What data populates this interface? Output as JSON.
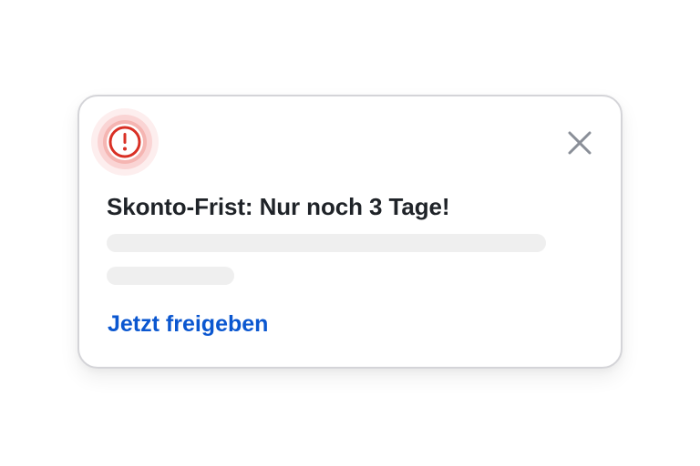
{
  "notification": {
    "icon": "alert-circle-icon",
    "accent_color": "#d93025",
    "title": "Skonto-Frist: Nur noch 3 Tage!",
    "action_label": "Jetzt freigeben",
    "action_color": "#0b57d0",
    "close_icon": "close-icon"
  }
}
